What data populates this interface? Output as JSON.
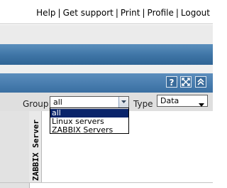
{
  "top_links": {
    "items": [
      "Help",
      "Get support",
      "Print",
      "Profile",
      "Logout"
    ],
    "separator": "|"
  },
  "header_icons": [
    "help-icon",
    "fullscreen-icon",
    "collapse-icon"
  ],
  "filter": {
    "group_label": "Group",
    "group_value": "all",
    "type_label": "Type",
    "type_value": "Data"
  },
  "dropdown": {
    "options": [
      "all",
      "Linux servers",
      "ZABBIX Servers"
    ],
    "selected_index": 0
  },
  "table": {
    "column_header": "ZABBIX Server"
  },
  "colors": {
    "blue_bar": "#3e74a5",
    "selection": "#0a246a"
  }
}
